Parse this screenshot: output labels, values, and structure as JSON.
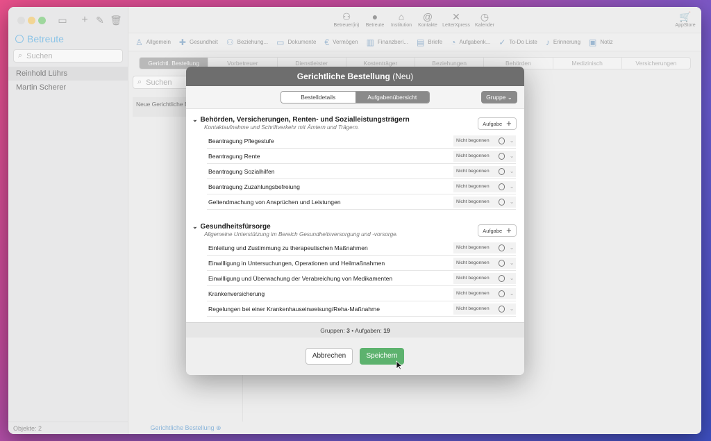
{
  "sidebar": {
    "title": "Betreute",
    "search_placeholder": "Suchen",
    "items": [
      "Reinhold Lührs",
      "Martin Scherer"
    ],
    "footer": "Objekte: 2"
  },
  "toolbar": {
    "items": [
      {
        "label": "Betreuer(in)",
        "icon": "people-icon"
      },
      {
        "label": "Betreute",
        "icon": "person-icon"
      },
      {
        "label": "Institution",
        "icon": "building-icon"
      },
      {
        "label": "Kontakte",
        "icon": "at-icon"
      },
      {
        "label": "LetterXpress",
        "icon": "letterxpress-icon"
      },
      {
        "label": "Kalender",
        "icon": "clock-icon"
      }
    ],
    "appstore": "AppStore"
  },
  "tabs2": [
    "Allgemein",
    "Gesundheit",
    "Beziehung...",
    "Dokumente",
    "Vermögen",
    "Finanzberi...",
    "Briefe",
    "Aufgabenk...",
    "To-Do Liste",
    "Erinnerung",
    "Notiz"
  ],
  "subtabs": [
    "Gerichtl. Bestellung",
    "Vorbetreuer",
    "Dienstleister",
    "Kostenträger",
    "Beziehungen",
    "Behörden",
    "Medizinisch",
    "Versicherungen"
  ],
  "list2": {
    "search_placeholder": "Suchen",
    "item": "Neue Gerichtliche B",
    "footer": "Gerichtliche Bestellung"
  },
  "modal": {
    "title": "Gerichtliche Bestellung",
    "title_suffix": "(Neu)",
    "seg": [
      "Bestelldetails",
      "Aufgabenübersicht"
    ],
    "group_button": "Gruppe",
    "add_label": "Aufgabe",
    "status": "Nicht begonnen",
    "groups": [
      {
        "title": "Behörden, Versicherungen, Renten- und Sozialleistungsträgern",
        "subtitle": "Kontaktaufnahme und Schriftverkehr mit Ämtern und Trägern.",
        "tasks": [
          "Beantragung Pflegestufe",
          "Beantragung Rente",
          "Beantragung Sozialhilfen",
          "Beantragung Zuzahlungsbefreiung",
          "Geltendmachung von Ansprüchen und Leistungen"
        ]
      },
      {
        "title": "Gesundheitsfürsorge",
        "subtitle": "Allgemeine Unterstützung im Bereich Gesundheitsversorgung und -vorsorge.",
        "tasks": [
          "Einleitung und Zustimmung zu therapeutischen Maßnahmen",
          "Einwilligung in Untersuchungen, Operationen und Heilmaßnahmen",
          "Einwilligung und Überwachung der Verabreichung von Medikamenten",
          "Krankenversicherung",
          "Regelungen bei einer Krankenhauseinweisung/Reha-Maßnahme"
        ]
      }
    ],
    "summary": {
      "groups_label": "Gruppen:",
      "groups_count": "3",
      "sep": "•",
      "tasks_label": "Aufgaben:",
      "tasks_count": "19"
    },
    "cancel": "Abbrechen",
    "save": "Speichern"
  },
  "colors": {
    "accent": "#3aa0e0",
    "save": "#5db26e",
    "header": "#6e6e6e"
  }
}
